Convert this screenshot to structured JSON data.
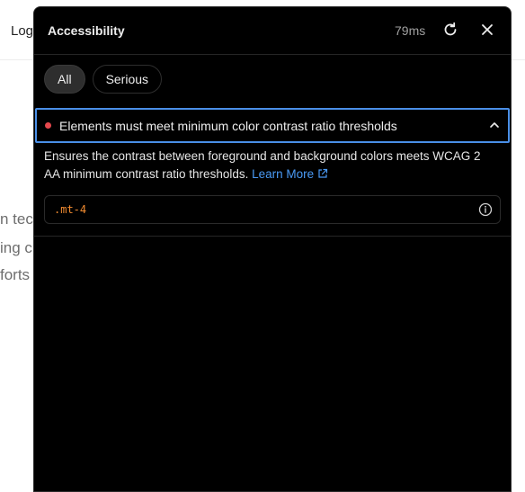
{
  "background": {
    "login_text": "Log",
    "text_fragments": [
      "n tec",
      "ing c",
      "forts"
    ]
  },
  "panel": {
    "title": "Accessibility",
    "timing": "79ms",
    "refresh_icon": "refresh-icon",
    "close_icon": "close-icon"
  },
  "filters": {
    "all_label": "All",
    "serious_label": "Serious",
    "selected": "All"
  },
  "issue": {
    "title": "Elements must meet minimum color contrast ratio thresholds",
    "severity_color": "#e5484d",
    "expanded": true,
    "description": "Ensures the contrast between foreground and background colors meets WCAG 2 AA minimum contrast ratio thresholds.",
    "learn_more_label": "Learn More",
    "selector": ".mt-4"
  },
  "colors": {
    "panel_bg": "#000000",
    "accent_blue": "#4a8fe7",
    "link_blue": "#4a9af5",
    "selector_orange": "#f28b30"
  }
}
